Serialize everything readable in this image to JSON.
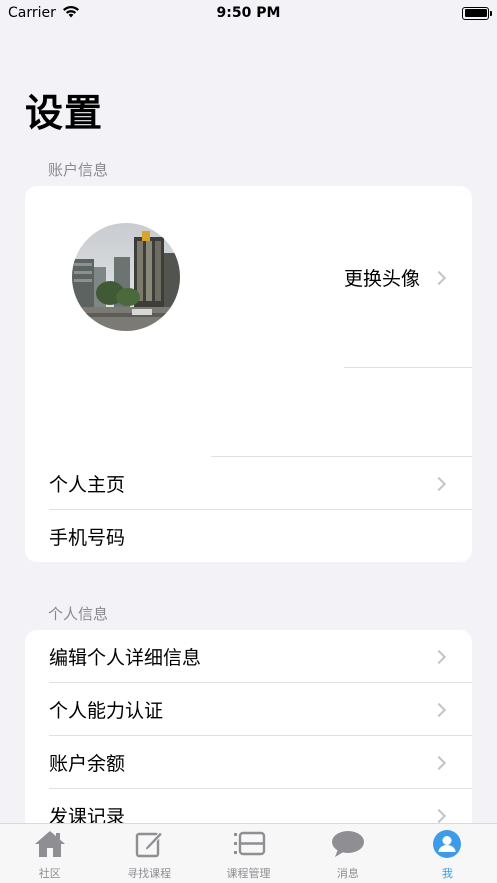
{
  "status_bar": {
    "carrier": "Carrier",
    "time": "9:50 PM"
  },
  "page_title": "设置",
  "account_section": {
    "header": "账户信息",
    "change_avatar_label": "更换头像",
    "rows": [
      {
        "label": "个人主页",
        "chevron": true
      },
      {
        "label": "手机号码",
        "chevron": false
      }
    ]
  },
  "personal_section": {
    "header": "个人信息",
    "rows": [
      {
        "label": "编辑个人详细信息"
      },
      {
        "label": "个人能力认证"
      },
      {
        "label": "账户余额"
      },
      {
        "label": "发课记录"
      }
    ]
  },
  "tab_bar": {
    "items": [
      {
        "label": "社区",
        "icon": "house-icon"
      },
      {
        "label": "寻找课程",
        "icon": "edit-icon"
      },
      {
        "label": "课程管理",
        "icon": "list-icon"
      },
      {
        "label": "消息",
        "icon": "chat-bubble-icon"
      },
      {
        "label": "我",
        "icon": "person-icon"
      }
    ],
    "active_index": 4
  },
  "colors": {
    "accent": "#3d9be9",
    "background": "#f2f2f7",
    "inactive_tab": "#8e8e93"
  }
}
